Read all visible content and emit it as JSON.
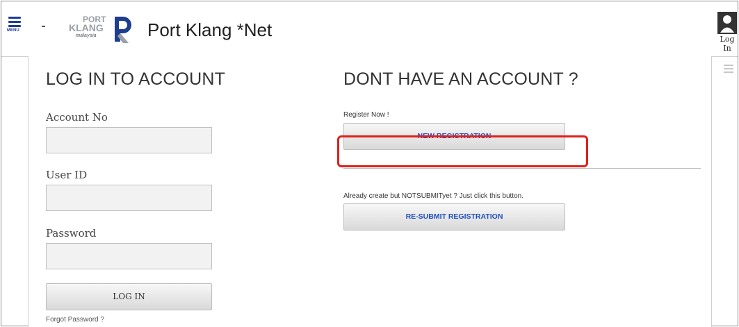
{
  "header": {
    "menu_label": "MENU",
    "logo": {
      "line1": "PORT",
      "line2": "KLANG",
      "line3": "malaysia"
    },
    "title": "Port Klang *Net",
    "login_label": "Log In"
  },
  "login": {
    "heading": "LOG IN TO ACCOUNT",
    "account_label": "Account No",
    "account_value": "",
    "userid_label": "User ID",
    "userid_value": "",
    "password_label": "Password",
    "password_value": "",
    "login_button": "LOG IN",
    "forgot_link": "Forgot Password ?"
  },
  "register": {
    "heading": "DONT HAVE AN ACCOUNT ?",
    "register_now": "Register Now !",
    "new_button": "NEW REGISTRATION",
    "already_text": "Already create but NOTSUBMITyet ? Just click this button.",
    "resubmit_button": "RE-SUBMIT REGISTRATION"
  },
  "colors": {
    "accent_blue": "#1f4fbf",
    "logo_blue": "#1f3d8f",
    "highlight_red": "#e0201a"
  }
}
